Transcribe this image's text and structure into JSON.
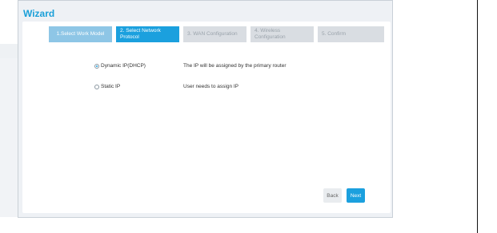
{
  "wizard": {
    "title": "Wizard",
    "steps": [
      {
        "label": "1.Select Work Model",
        "state": "done"
      },
      {
        "label": "2. Select Network Protocol",
        "state": "active"
      },
      {
        "label": "3. WAN Configuration",
        "state": "pending"
      },
      {
        "label": "4. Wireless Configuration",
        "state": "pending"
      },
      {
        "label": "5. Confirm",
        "state": "pending"
      }
    ],
    "options": [
      {
        "label": "Dynamic IP(DHCP)",
        "description": "The IP will be assigned by the primary router",
        "selected": true
      },
      {
        "label": "Static IP",
        "description": "User needs to assign IP",
        "selected": false
      }
    ],
    "back_label": "Back",
    "next_label": "Next"
  },
  "colors": {
    "accent": "#1ba0de",
    "step_done": "#8ec6e6",
    "step_pending": "#d9dde2"
  }
}
